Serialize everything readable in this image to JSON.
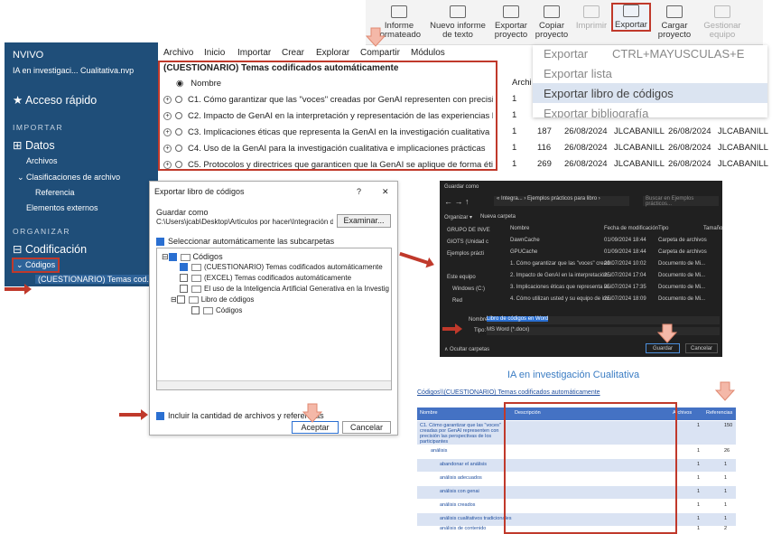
{
  "ribbon": {
    "items": [
      {
        "label": "Informe\nformateado",
        "disabled": false
      },
      {
        "label": "Nuevo informe\nde texto",
        "disabled": false
      },
      {
        "label": "Exportar\nproyecto",
        "disabled": false
      },
      {
        "label": "Copiar\nproyecto",
        "disabled": false
      },
      {
        "label": "Imprimir",
        "disabled": true
      },
      {
        "label": "Exportar",
        "disabled": false
      },
      {
        "label": "Cargar\nproyecto",
        "disabled": false
      },
      {
        "label": "Gestionar\nequipo",
        "disabled": true
      }
    ]
  },
  "sidebar": {
    "app": "NVIVO",
    "project": "IA en investigaci... Cualitativa.nvp",
    "quick": "Acceso rápido",
    "sec_import": "IMPORTAR",
    "datos": "Datos",
    "archivos": "Archivos",
    "clasif": "Clasificaciones de archivo",
    "referencia": "Referencia",
    "externos": "Elementos externos",
    "sec_org": "ORGANIZAR",
    "codificacion": "Codificación",
    "codigos": "Códigos",
    "cuest": "(CUESTIONARIO) Temas cod..."
  },
  "menubar": [
    "Archivo",
    "Inicio",
    "Importar",
    "Crear",
    "Explorar",
    "Compartir",
    "Módulos"
  ],
  "list": {
    "title": "(CUESTIONARIO) Temas codificados automáticamente",
    "col_name": "Nombre",
    "col_arch": "Archi",
    "rows": [
      {
        "name": "C1. Cómo garantizar que las \"voces\" creadas por GenAI representen con precisión",
        "n": "1",
        "refs": "",
        "date1": "",
        "user1": "",
        "date2": "",
        "user2": ""
      },
      {
        "name": "C2. Impacto de GenAI en la interpretación y representación de las experiencias hu",
        "n": "1",
        "refs": "",
        "date1": "",
        "user1": "",
        "date2": "",
        "user2": ""
      },
      {
        "name": "C3. Implicaciones éticas que representa la GenAI en la investigación cualitativa",
        "n": "1",
        "refs": "187",
        "date1": "26/08/2024",
        "user1": "JLCABANILL",
        "date2": "26/08/2024",
        "user2": "JLCABANILL"
      },
      {
        "name": "C4. Uso de la GenAI para la investigación cualitativa e implicaciones prácticas",
        "n": "1",
        "refs": "116",
        "date1": "26/08/2024",
        "user1": "JLCABANILL",
        "date2": "26/08/2024",
        "user2": "JLCABANILL"
      },
      {
        "name": "C5. Protocolos y directrices que garanticen que la GenAI se aplique de forma étic",
        "n": "1",
        "refs": "269",
        "date1": "26/08/2024",
        "user1": "JLCABANILL",
        "date2": "26/08/2024",
        "user2": "JLCABANILL"
      }
    ]
  },
  "dropdown": [
    "Exportar",
    "CTRL+MAYUSCULAS+E",
    "Exportar lista",
    "Exportar libro de códigos",
    "Exportar bibliografía"
  ],
  "dialog": {
    "title": "Exportar libro de códigos",
    "help": "?",
    "close": "✕",
    "save_as": "Guardar como",
    "path": "C:\\Users\\jcab\\Desktop\\Articulos por hacer\\Integración de la",
    "browse": "Examinar...",
    "auto": "Seleccionar automáticamente las subcarpetas",
    "tree": [
      "Códigos",
      "(CUESTIONARIO) Temas codificados automáticamente",
      "(EXCEL) Temas codificados automáticamente",
      "El uso de la Inteligencia Artificial Generativa en la Investigación C",
      "Libro de códigos",
      "Códigos"
    ],
    "include": "Incluir la cantidad de archivos y referencias",
    "accept": "Aceptar",
    "cancel": "Cancelar"
  },
  "saveas": {
    "title": "Guardar como",
    "crumb": "« Integra... › Ejemplos prácticos para libro ›",
    "search": "Buscar en Ejemplos prácticos...",
    "organize": "Organizar ▾",
    "newfolder": "Nueva carpeta",
    "h_name": "Nombre",
    "h_date": "Fecha de modificación",
    "h_type": "Tipo",
    "h_size": "Tamaño",
    "left": [
      "GRUPO DE INVE",
      "GIOTS (Unidad c",
      "Ejemplos prácti",
      "Este equipo",
      "Windows (C:)",
      "Red"
    ],
    "files": [
      {
        "n": "DawnCache",
        "d": "01/09/2024 18:44",
        "t": "Carpeta de archivos"
      },
      {
        "n": "GPUCache",
        "d": "01/09/2024 18:44",
        "t": "Carpeta de archivos"
      },
      {
        "n": "1. Cómo garantizar que las \"voces\" cread...",
        "d": "29/07/2024 10:02",
        "t": "Documento de Mi..."
      },
      {
        "n": "2. Impacto de GenAI en la interpretación...",
        "d": "25/07/2024 17:04",
        "t": "Documento de Mi..."
      },
      {
        "n": "3. Implicaciones éticas que representa la...",
        "d": "25/07/2024 17:35",
        "t": "Documento de Mi..."
      },
      {
        "n": "4. Cómo utilizan usted y su equipo de inv...",
        "d": "25/07/2024 18:09",
        "t": "Documento de Mi..."
      }
    ],
    "name_label": "Nombre:",
    "name_val": "Libro de códigos en Word",
    "type_label": "Tipo:",
    "type_val": "MS Word (*.docx)",
    "hide": "∧ Ocultar carpetas",
    "save": "Guardar",
    "cancel": "Cancelar"
  },
  "doc": {
    "title": "IA en investigación Cualitativa",
    "path": "Códigos\\\\(CUESTIONARIO) Temas codificados automáticamente",
    "h": [
      "Nombre",
      "Descripción",
      "Archivos",
      "Referencias"
    ],
    "rows": [
      {
        "n": "C1. Cómo garantizar que las \"voces\" creadas por GenAI representen con precisión las perspectivas de los participantes",
        "a": "1",
        "r": "150"
      },
      {
        "n": "análisis",
        "a": "1",
        "r": "26"
      },
      {
        "n": "abandonar el análisis",
        "a": "1",
        "r": "1"
      },
      {
        "n": "análisis adecuados",
        "a": "1",
        "r": "1"
      },
      {
        "n": "análisis con genai",
        "a": "1",
        "r": "1"
      },
      {
        "n": "análisis creados",
        "a": "1",
        "r": "1"
      },
      {
        "n": "análisis cualitativos tradicionales",
        "a": "1",
        "r": "1"
      },
      {
        "n": "análisis de contenido",
        "a": "1",
        "r": "2"
      }
    ]
  }
}
